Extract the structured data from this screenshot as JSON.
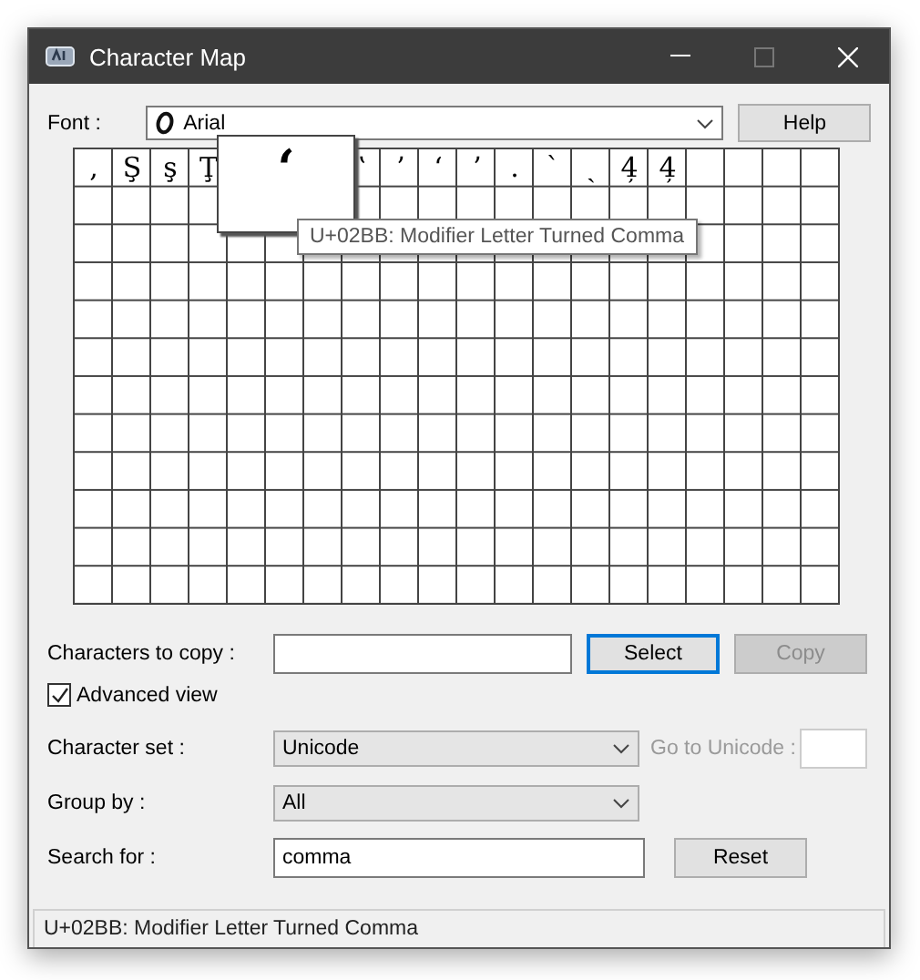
{
  "window": {
    "title": "Character Map"
  },
  "font": {
    "label": "Font :",
    "value": "Arial"
  },
  "help_button": "Help",
  "grid": {
    "chars_before_magnifier": [
      ",",
      "Ş",
      "ş",
      "Ţ"
    ],
    "chars_after_magnifier": [
      "ʽ",
      "ʼ",
      "ʻ",
      "ʼ",
      ".",
      "ˋ",
      "ˏ",
      "4̦",
      "4̦"
    ],
    "magnified_char": "ʻ",
    "tooltip": "U+02BB: Modifier Letter Turned Comma"
  },
  "copy": {
    "label": "Characters to copy :",
    "select_button": "Select",
    "copy_button": {
      "label": "Copy",
      "disabled": true
    }
  },
  "advanced_view": {
    "label": "Advanced view",
    "checked": true
  },
  "character_set": {
    "label": "Character set :",
    "value": "Unicode"
  },
  "go_to_unicode": {
    "label": "Go to Unicode :",
    "disabled": true
  },
  "group_by": {
    "label": "Group by :",
    "value": "All"
  },
  "search": {
    "label": "Search for :",
    "value": "comma",
    "reset_button": "Reset"
  },
  "status_bar": "U+02BB: Modifier Letter Turned Comma"
}
